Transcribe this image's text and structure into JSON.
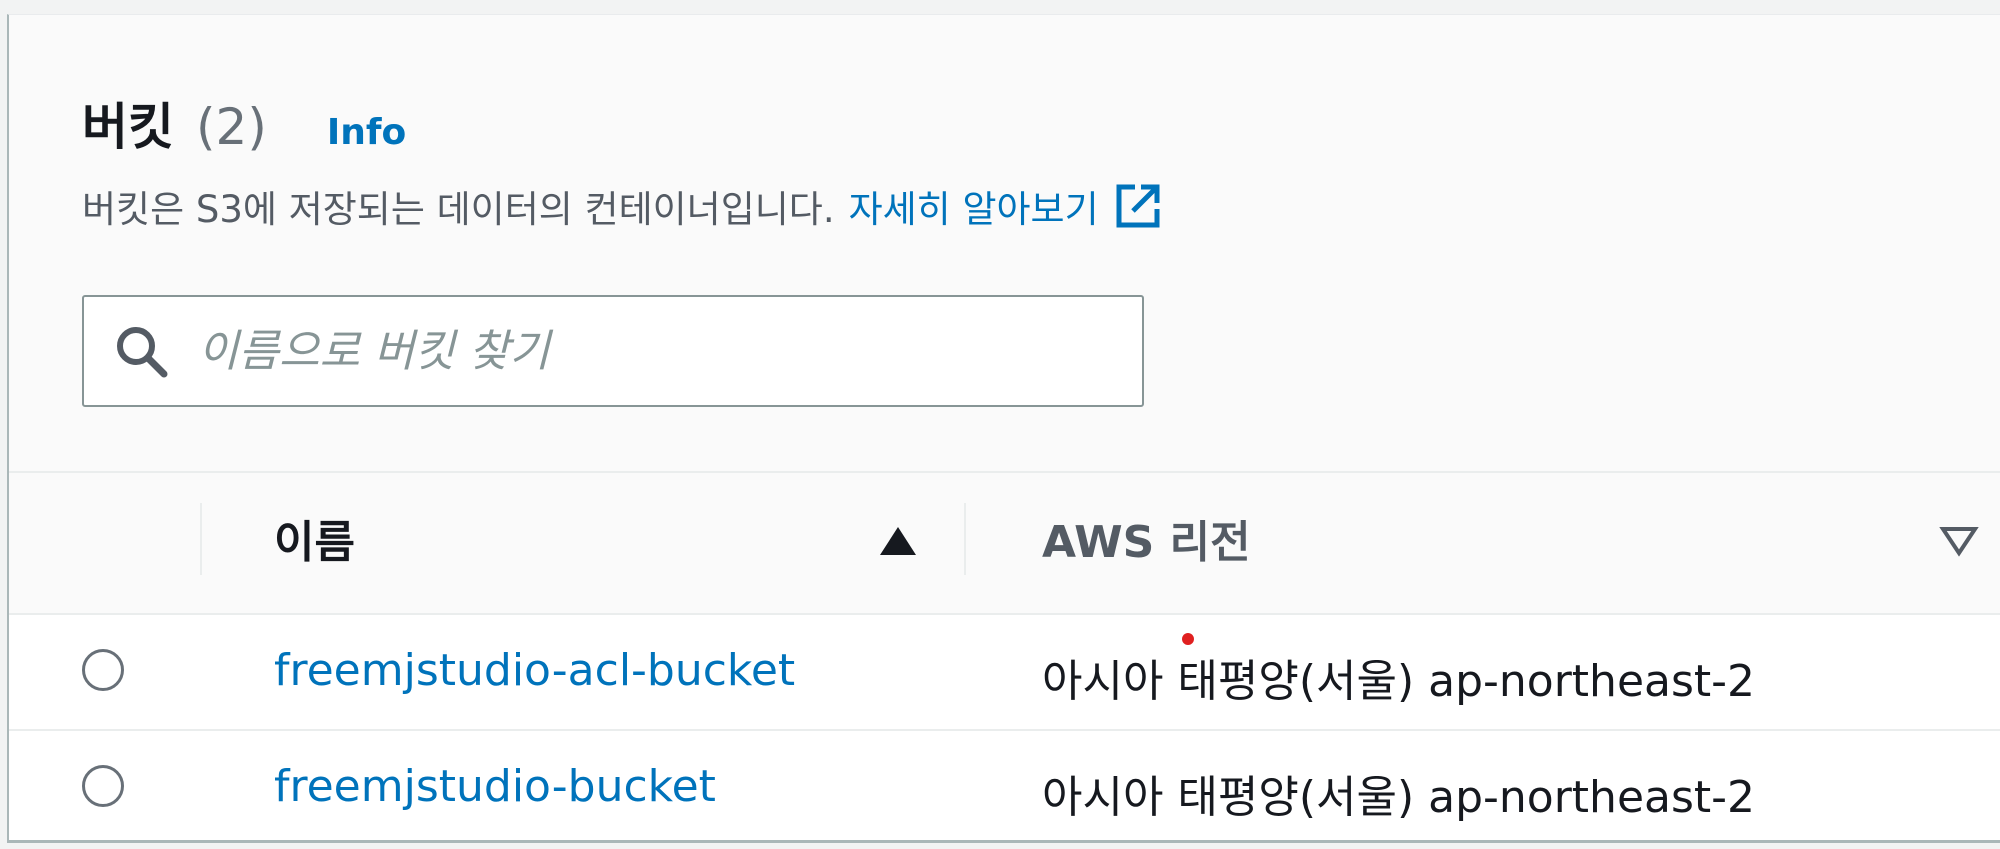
{
  "header": {
    "title": "버킷",
    "count": "(2)",
    "info_link": "Info",
    "description": "버킷은 S3에 저장되는 데이터의 컨테이너입니다.",
    "learn_more": "자세히 알아보기",
    "learn_more_icon": "external-link-icon"
  },
  "search": {
    "icon": "search-icon",
    "placeholder": "이름으로 버킷 찾기",
    "value": ""
  },
  "table": {
    "columns": [
      {
        "label": "이름",
        "sort": "ascending",
        "sort_icon": "sort-ascending-icon"
      },
      {
        "label": "AWS 리전",
        "sort": "none",
        "sort_icon": "sort-descending-outline-icon"
      }
    ],
    "rows": [
      {
        "name": "freemjstudio-acl-bucket",
        "region": "아시아 태평양(서울) ap-northeast-2",
        "selected": false
      },
      {
        "name": "freemjstudio-bucket",
        "region": "아시아 태평양(서울) ap-northeast-2",
        "selected": false
      }
    ]
  },
  "colors": {
    "link": "#0073bb",
    "text": "#16191f",
    "muted": "#545b64",
    "border": "#879596",
    "header_bg": "#fafafa"
  }
}
